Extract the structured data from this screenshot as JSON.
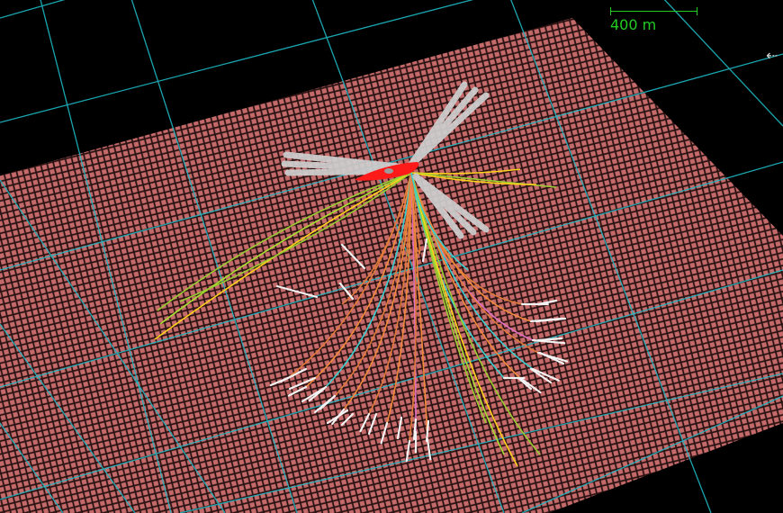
{
  "scale_bar": {
    "label": "400 m"
  },
  "nav": {
    "arrow_glyph": "⇠"
  },
  "colors": {
    "background": "#000000",
    "grid": "#1fb8c4",
    "seabed_cells": "#c46a6a",
    "scale": "#22cc22",
    "vessel": "#ff1a1a",
    "mooring": "#cfcfcf",
    "cable_colors": [
      "#9acd32",
      "#ffd21a",
      "#e07a3a",
      "#f08a3a",
      "#3ad0d0",
      "#e070c0",
      "#a8e030"
    ]
  },
  "icons": {
    "nav": "left-arrow-icon"
  }
}
